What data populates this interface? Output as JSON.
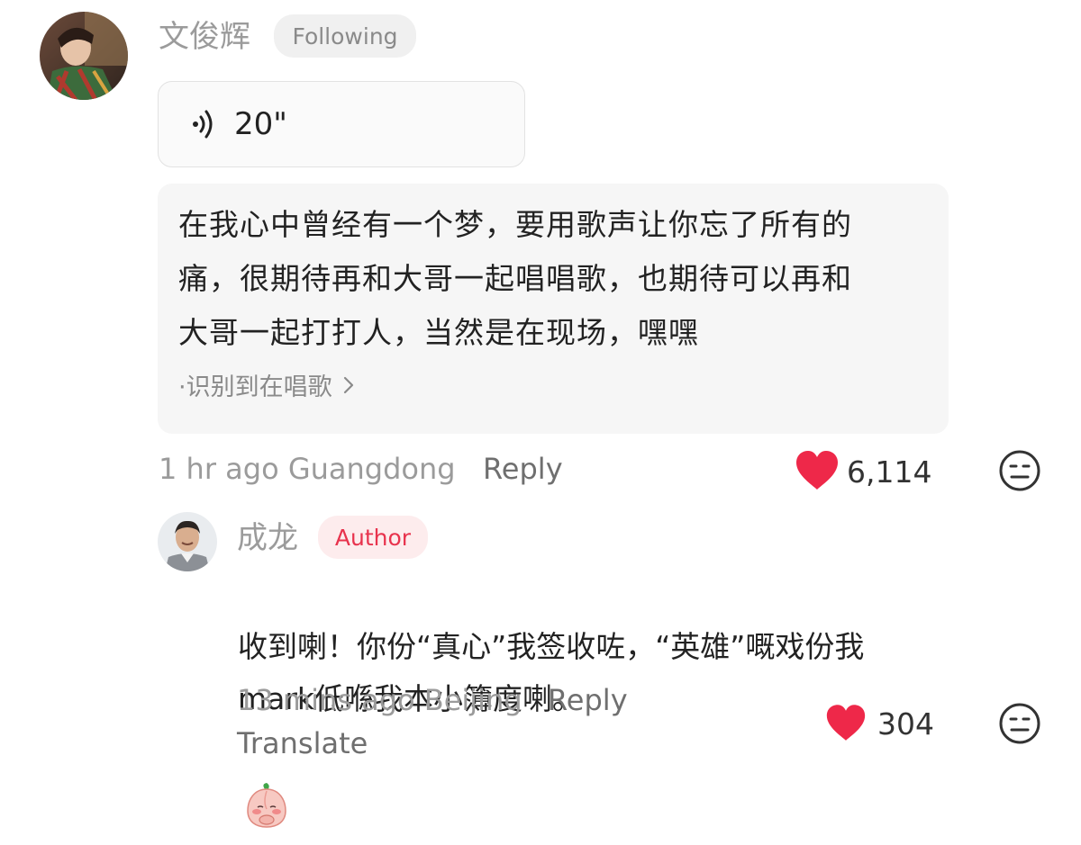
{
  "colors": {
    "heart": "#ee2849",
    "author_badge_text": "#e8334d",
    "author_badge_bg": "#fdeced",
    "muted_text": "#9b9b9b"
  },
  "comment": {
    "username": "文俊辉",
    "follow_status": "Following",
    "voice_duration": "20\"",
    "transcript": "在我心中曾经有一个梦，要用歌声让你忘了所有的\n痛，很期待再和大哥一起唱唱歌，也期待可以再和\n大哥一起打打人，当然是在现场，嘿嘿",
    "detection_note": "·识别到在唱歌",
    "time_location": "1 hr ago Guangdong",
    "reply_label": "Reply",
    "like_count": "6,114",
    "icons": {
      "voice": "sound-wave-icon",
      "like": "heart-icon",
      "dislike": "meh-face-icon"
    }
  },
  "reply": {
    "username": "成龙",
    "badge": "Author",
    "text": "收到喇！你份“真心”我签收咗，“英雄”嘅戏份我\nmark低喺我本小簿度喇。",
    "emoji": "blushing-peach-sticker",
    "time_location": "13 mins ago Beijing",
    "reply_label": "Reply",
    "translate_label": "Translate",
    "like_count": "304",
    "icons": {
      "like": "heart-icon",
      "dislike": "meh-face-icon"
    }
  }
}
